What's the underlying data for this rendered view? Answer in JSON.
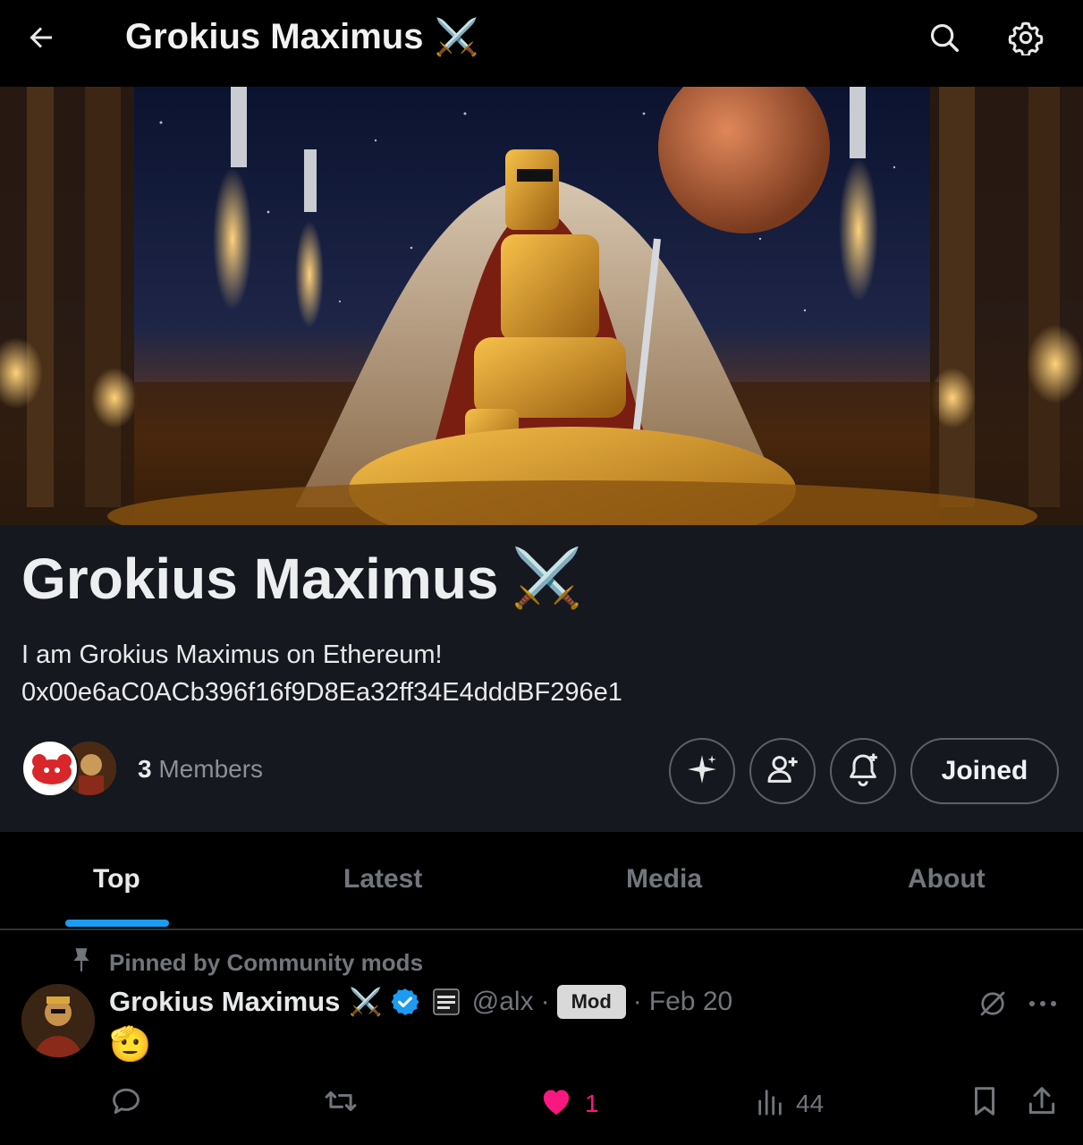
{
  "topbar": {
    "title": "Grokius Maximus",
    "title_emoji": "⚔️"
  },
  "community": {
    "name": "Grokius Maximus",
    "name_emoji": "⚔️",
    "description_line1": "I am Grokius Maximus on Ethereum!",
    "description_line2": "0x00e6aC0ACb396f16f9D8Ea32ff34E4dddBF296e1",
    "member_count": "3",
    "members_label": " Members",
    "joined_label": "Joined"
  },
  "tabs": [
    {
      "label": "Top",
      "active": true
    },
    {
      "label": "Latest",
      "active": false
    },
    {
      "label": "Media",
      "active": false
    },
    {
      "label": "About",
      "active": false
    }
  ],
  "post": {
    "pinned_label": "Pinned by Community mods",
    "author": "Grokius Maximus",
    "author_emoji": "⚔️",
    "handle": "@alx",
    "mod_badge": "Mod",
    "date": "Feb 20",
    "content_emoji": "🫡",
    "likes": "1",
    "views": "44"
  },
  "icons": {
    "back": "arrow-left-icon",
    "search": "search-icon",
    "settings": "gear-icon",
    "grok": "sparkle-icon",
    "invite": "person-add-icon",
    "notify": "bell-plus-icon",
    "pin": "pin-icon",
    "verified": "verified-badge-icon",
    "reply": "reply-icon",
    "repost": "repost-icon",
    "like": "heart-icon",
    "views": "views-icon",
    "bookmark": "bookmark-icon",
    "share": "share-icon"
  },
  "colors": {
    "accent": "#1d9bf0",
    "like": "#f91880",
    "header_bg": "#16181f"
  }
}
